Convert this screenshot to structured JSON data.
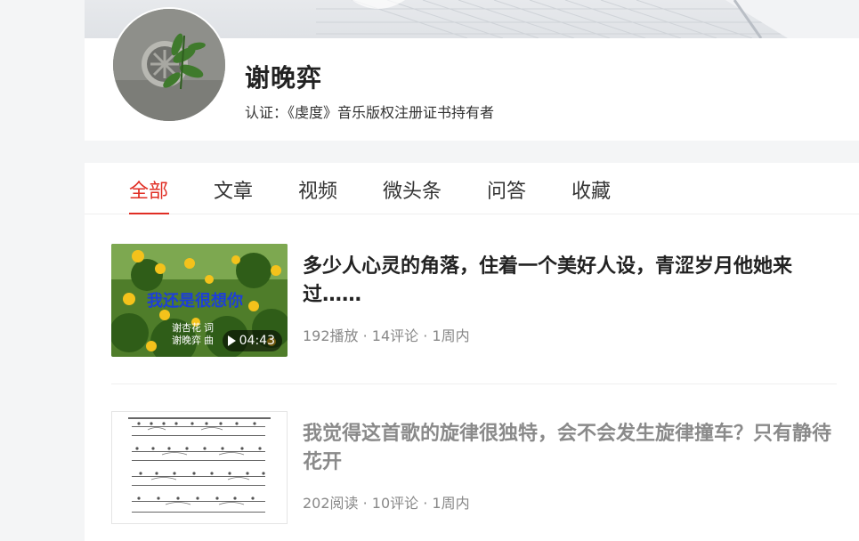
{
  "profile": {
    "name": "谢晚弈",
    "verification": "认证：《虔度》音乐版权注册证书持有者"
  },
  "tabs": [
    {
      "label": "全部",
      "active": true
    },
    {
      "label": "文章",
      "active": false
    },
    {
      "label": "视频",
      "active": false
    },
    {
      "label": "微头条",
      "active": false
    },
    {
      "label": "问答",
      "active": false
    },
    {
      "label": "收藏",
      "active": false
    }
  ],
  "feed": [
    {
      "title": "多少人心灵的角落，住着一个美好人设，青涩岁月他她来过……",
      "meta": "192播放 · 14评论 · 1周内",
      "duration": "04:43",
      "thumb_text": "我还是很想你",
      "thumb_credit_1": "谢杏花  词",
      "thumb_credit_2": "谢晚弈  曲"
    },
    {
      "title": "我觉得这首歌的旋律很独特，会不会发生旋律撞车？只有静待花开",
      "meta": "202阅读 · 10评论 · 1周内"
    }
  ],
  "colors": {
    "accent": "#e02e24",
    "text": "#222222",
    "meta": "#888888"
  }
}
